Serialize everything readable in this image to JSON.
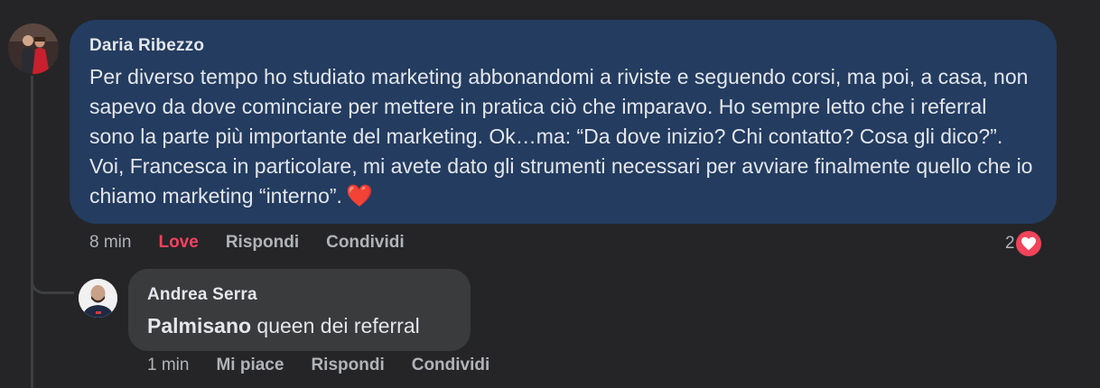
{
  "comments": [
    {
      "author": "Daria Ribezzo",
      "text": "Per diverso tempo ho studiato marketing abbonandomi a riviste e seguendo corsi, ma poi, a casa, non sapevo da dove cominciare per mettere in pratica ciò che imparavo. Ho sempre letto che i referral sono la parte più importante del marketing. Ok…ma: “Da dove inizio? Chi contatto? Cosa gli dico?”. Voi, Francesca in particolare, mi avete dato gli strumenti necessari per avviare finalmente quello che io chiamo marketing “interno”.",
      "emoji": "❤️",
      "time": "8 min",
      "reaction_label": "Love",
      "reply_label": "Rispondi",
      "share_label": "Condividi",
      "reaction_count": "2",
      "reaction_icon": "heart-icon",
      "reaction_color": "#f3425f"
    },
    {
      "author": "Andrea Serra",
      "mention": "Palmisano",
      "text": " queen dei referral",
      "time": "1 min",
      "reaction_label": "Mi piace",
      "reply_label": "Rispondi",
      "share_label": "Condividi"
    }
  ],
  "colors": {
    "background": "#252527",
    "bubble_primary": "#233c60",
    "bubble_secondary": "#3a3b3d",
    "love": "#f3425f"
  }
}
